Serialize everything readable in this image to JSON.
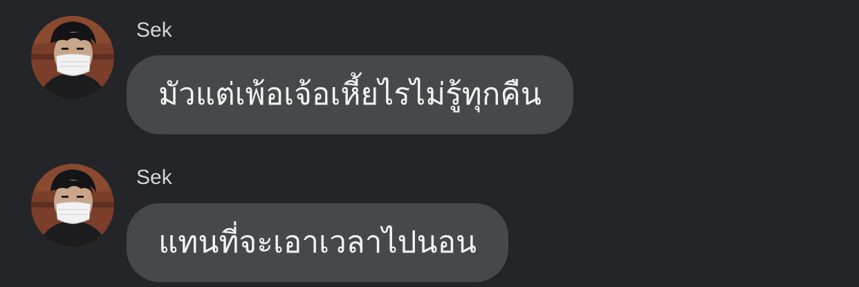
{
  "colors": {
    "background": "#242529",
    "bubble": "#47484c",
    "bubble_text": "#f2f2f3",
    "sender_text": "#d6d6d8"
  },
  "messages": [
    {
      "sender": "Sek",
      "avatar_icon": "user-avatar-masked-character",
      "text": "มัวแต่เพ้อเจ้อเหี้ยไรไม่รู้ทุกคืน"
    },
    {
      "sender": "Sek",
      "avatar_icon": "user-avatar-masked-character",
      "text": "แทนที่จะเอาเวลาไปนอน"
    }
  ]
}
